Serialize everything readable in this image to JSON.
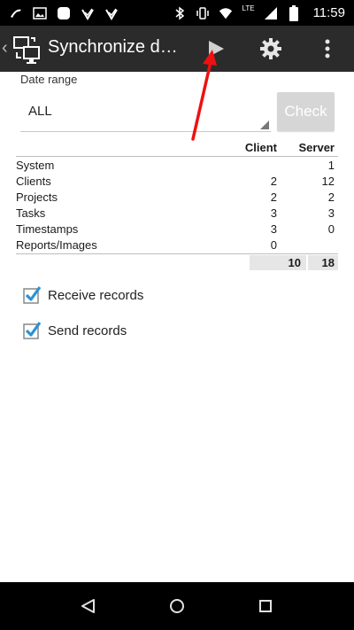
{
  "status_bar": {
    "time": "11:59",
    "network": "LTE",
    "left_icons": [
      "app-icon-1",
      "image-icon",
      "circle-app-icon",
      "check-icon",
      "check-icon-2"
    ],
    "right_icons": [
      "bluetooth-icon",
      "vibrate-icon",
      "wifi-icon",
      "signal-icon",
      "battery-icon"
    ]
  },
  "action_bar": {
    "title": "Synchronize da…"
  },
  "form": {
    "date_range_label": "Date range",
    "date_range_value": "ALL",
    "check_button": "Check"
  },
  "table": {
    "headers": {
      "client": "Client",
      "server": "Server"
    },
    "rows": [
      {
        "label": "System",
        "client": "",
        "server": "1"
      },
      {
        "label": "Clients",
        "client": "2",
        "server": "12"
      },
      {
        "label": "Projects",
        "client": "2",
        "server": "2"
      },
      {
        "label": "Tasks",
        "client": "3",
        "server": "3"
      },
      {
        "label": "Timestamps",
        "client": "3",
        "server": "0"
      },
      {
        "label": "Reports/Images",
        "client": "0",
        "server": ""
      }
    ],
    "totals": {
      "client": "10",
      "server": "18"
    }
  },
  "options": {
    "receive_label": "Receive records",
    "receive_checked": true,
    "send_label": "Send records",
    "send_checked": true
  },
  "colors": {
    "action_bar": "#2b2b2b",
    "accent_check": "#2a93d5",
    "annotation_arrow": "#ee1111"
  }
}
